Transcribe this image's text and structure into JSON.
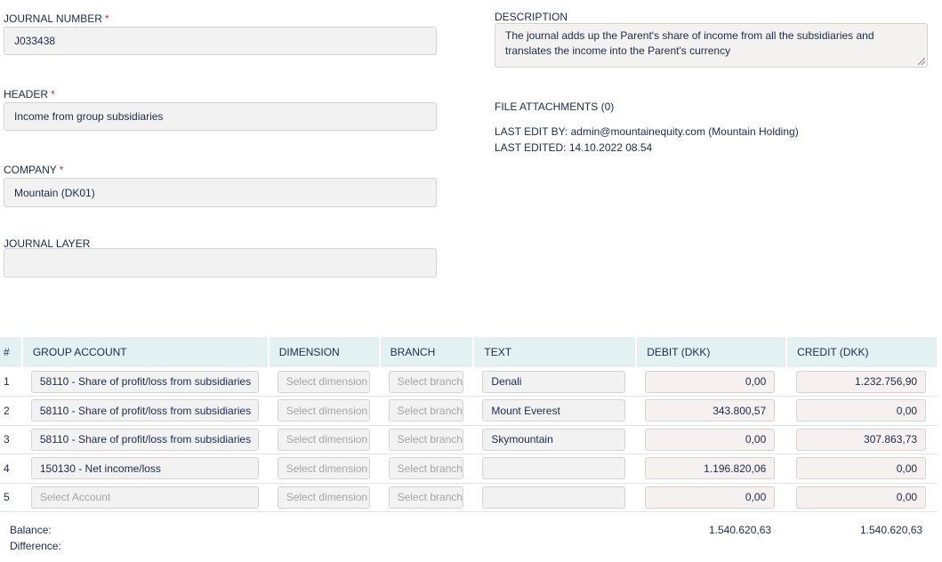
{
  "form": {
    "journal_number_label": "JOURNAL NUMBER",
    "journal_number_value": "J033438",
    "header_label": "HEADER",
    "header_value": "Income from group subsidiaries",
    "company_label": "COMPANY",
    "company_value": "Mountain (DK01)",
    "journal_layer_label": "JOURNAL LAYER",
    "journal_layer_value": "",
    "required_mark": "*",
    "description_label": "DESCRIPTION",
    "description_value": "The journal adds up the Parent's share of income from all the subsidiaries and translates the income into the Parent's currency",
    "file_attachments": "FILE ATTACHMENTS (0)",
    "last_edit_by_label": "LAST EDIT BY:",
    "last_edit_by_value": "admin@mountainequity.com (Mountain Holding)",
    "last_edited_label": "LAST EDITED:",
    "last_edited_value": "14.10.2022 08.54"
  },
  "table": {
    "headers": {
      "num": "#",
      "group_account": "GROUP ACCOUNT",
      "dimension": "DIMENSION",
      "branch": "BRANCH",
      "text": "TEXT",
      "debit": "DEBIT (DKK)",
      "credit": "CREDIT (DKK)"
    },
    "rows": [
      {
        "num": "1",
        "account": "58110 - Share of profit/loss from subsidiaries",
        "dimension": "Select dimension",
        "branch": "Select branch",
        "text": "Denali",
        "debit": "0,00",
        "credit": "1.232.756,90"
      },
      {
        "num": "2",
        "account": "58110 - Share of profit/loss from subsidiaries",
        "dimension": "Select dimension",
        "branch": "Select branch",
        "text": "Mount Everest",
        "debit": "343.800,57",
        "credit": "0,00"
      },
      {
        "num": "3",
        "account": "58110 - Share of profit/loss from subsidiaries",
        "dimension": "Select dimension",
        "branch": "Select branch",
        "text": "Skymountain",
        "debit": "0,00",
        "credit": "307.863,73"
      },
      {
        "num": "4",
        "account": "150130 - Net income/loss",
        "dimension": "Select dimension",
        "branch": "Select branch",
        "text": "",
        "debit": "1.196.820,06",
        "credit": "0,00"
      },
      {
        "num": "5",
        "account": "Select Account",
        "dimension": "Select dimension",
        "branch": "Select branch",
        "text": "",
        "debit": "0,00",
        "credit": "0,00"
      }
    ],
    "account_placeholder_row": 4
  },
  "totals": {
    "balance_label": "Balance:",
    "difference_label": "Difference:",
    "debit_balance": "1.540.620,63",
    "credit_balance": "1.540.620,63"
  }
}
